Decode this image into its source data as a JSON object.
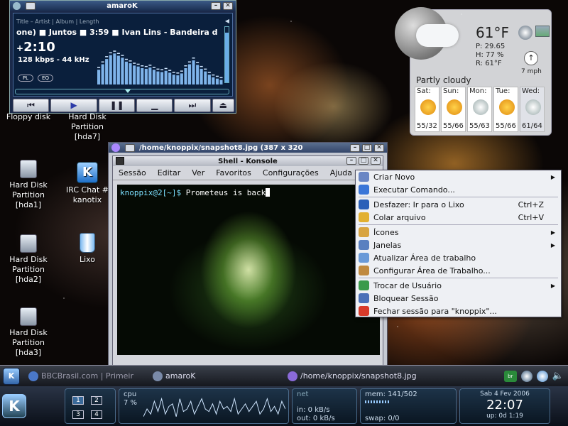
{
  "desktop": {
    "icons": [
      {
        "id": "floppy",
        "label": "Floppy disk"
      },
      {
        "id": "hda7",
        "label": "Hard Disk Partition [hda7]"
      },
      {
        "id": "hda1",
        "label": "Hard Disk Partition [hda1]"
      },
      {
        "id": "irc",
        "label": "IRC Chat # kanotix"
      },
      {
        "id": "hda2",
        "label": "Hard Disk Partition [hda2]"
      },
      {
        "id": "lixo",
        "label": "Lixo"
      },
      {
        "id": "hda3",
        "label": "Hard Disk Partition [hda3]"
      }
    ]
  },
  "amarok": {
    "window_title": "amaroK",
    "columns_header": "Title – Artist | Album | Length",
    "scroll_text": "one)  ■  Juntos  ■  3:59  ■  Ivan Lins - Bandeira d",
    "time": "2:10",
    "bitrate": "128 kbps - 44 kHz",
    "pl_label": "PL",
    "eq_label": "EQ",
    "progress": 0.52,
    "analyzer": [
      0.45,
      0.62,
      0.78,
      0.9,
      0.95,
      0.88,
      0.82,
      0.7,
      0.65,
      0.58,
      0.55,
      0.5,
      0.48,
      0.52,
      0.45,
      0.4,
      0.38,
      0.42,
      0.36,
      0.3,
      0.28,
      0.34,
      0.5,
      0.62,
      0.74,
      0.6,
      0.48,
      0.4,
      0.3,
      0.22,
      0.18,
      0.14
    ],
    "controls": {
      "prev": "⏮",
      "play": "▶",
      "pause": "❚❚",
      "stop": "▁",
      "next": "⏭",
      "eject": "⏏"
    }
  },
  "weather": {
    "temp": "61°F",
    "pressure": "P:  29.65",
    "humidity": "H:  77 %",
    "real": "R:  61°F",
    "wind": "7 mph",
    "condition": "Partly cloudy",
    "forecast": [
      {
        "day": "Sat:",
        "range": "55/32",
        "icon": "sun"
      },
      {
        "day": "Sun:",
        "range": "55/66",
        "icon": "sun"
      },
      {
        "day": "Mon:",
        "range": "55/63",
        "icon": "cloud"
      },
      {
        "day": "Tue:",
        "range": "55/66",
        "icon": "sun"
      },
      {
        "day": "Wed:",
        "range": "61/64",
        "icon": "cloud"
      }
    ]
  },
  "imageviewer": {
    "title": "/home/knoppix/snapshot8.jpg (387 x 320"
  },
  "konsole": {
    "title": "Shell - Konsole",
    "menu": [
      "Sessão",
      "Editar",
      "Ver",
      "Favoritos",
      "Configurações",
      "Ajuda"
    ],
    "prompt_user": "knoppix@2[~]$",
    "prompt_cmd": " Prometeus is back"
  },
  "context_menu": {
    "items": [
      {
        "label": "Criar Novo",
        "submenu": true,
        "shortcut": "",
        "icon": "#6a86c4"
      },
      {
        "label": "Executar Comando...",
        "submenu": false,
        "shortcut": "",
        "icon": "#3a76d8"
      },
      {
        "sep": true
      },
      {
        "label": "Desfazer: Ir para o Lixo",
        "submenu": false,
        "shortcut": "Ctrl+Z",
        "icon": "#2a5fb8"
      },
      {
        "label": "Colar arquivo",
        "submenu": false,
        "shortcut": "Ctrl+V",
        "icon": "#e2b030"
      },
      {
        "sep": true
      },
      {
        "label": "Ícones",
        "submenu": true,
        "shortcut": "",
        "icon": "#d8a440"
      },
      {
        "label": "Janelas",
        "submenu": true,
        "shortcut": "",
        "icon": "#5a80c0"
      },
      {
        "label": "Atualizar Área de trabalho",
        "submenu": false,
        "shortcut": "",
        "icon": "#6a9ad8"
      },
      {
        "label": "Configurar Área de Trabalho...",
        "submenu": false,
        "shortcut": "",
        "icon": "#c08a40"
      },
      {
        "sep": true
      },
      {
        "label": "Trocar de Usuário",
        "submenu": true,
        "shortcut": "",
        "icon": "#3a9a4a"
      },
      {
        "label": "Bloquear Sessão",
        "submenu": false,
        "shortcut": "",
        "icon": "#4a70b8"
      },
      {
        "label": "Fechar sessão para \"knoppix\"...",
        "submenu": false,
        "shortcut": "",
        "icon": "#d83a2a"
      }
    ]
  },
  "taskbar": {
    "tasks": [
      {
        "label": "BBCBrasil.com | Primeir",
        "color": "#4a78c8"
      },
      {
        "label": "amaroK",
        "color": "#7a8aa8"
      },
      {
        "label": "/home/knoppix/snapshot8.jpg",
        "color": "#8a6ad8"
      }
    ]
  },
  "panel": {
    "desktops": [
      "1",
      "2",
      "3",
      "4"
    ],
    "cpu_label": "cpu",
    "cpu_value": "7 %",
    "cpu_graph": [
      0.2,
      0.5,
      0.3,
      0.8,
      0.4,
      0.9,
      0.3,
      0.6,
      0.7,
      0.2,
      0.9,
      0.4,
      0.5,
      0.8,
      0.3,
      0.6,
      0.9,
      0.5,
      0.4,
      0.7,
      0.3,
      0.8,
      0.5,
      0.6,
      0.4,
      0.9,
      0.3,
      0.5,
      0.7,
      0.4,
      0.6,
      0.8,
      0.3,
      0.5,
      0.9,
      0.4,
      0.6,
      0.3,
      0.8,
      0.5
    ],
    "net_label": "net",
    "net_in": "in:  0 kB/s",
    "net_out": "out:  0 kB/s",
    "mem_label": "mem: 141/502",
    "swap_label": "swap: 0/0",
    "date": "Sab 4 Fev 2006",
    "time": "22:07",
    "uptime": "up: 0d 1:19"
  }
}
